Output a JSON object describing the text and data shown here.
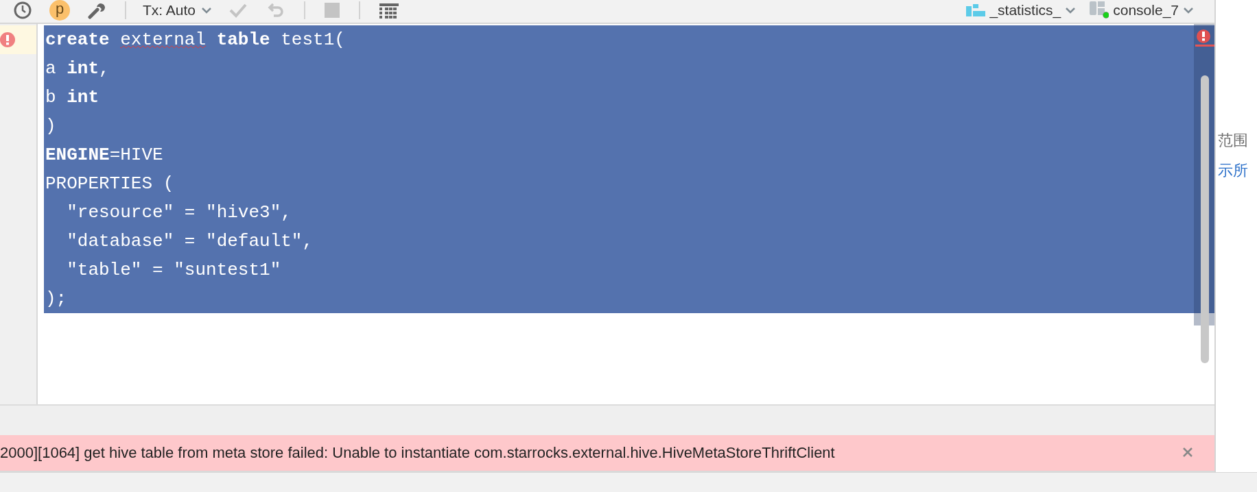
{
  "toolbar": {
    "items": [
      {
        "kind": "history",
        "disabled": false
      },
      {
        "kind": "avatar",
        "text": "p",
        "disabled": false
      },
      {
        "kind": "settings",
        "disabled": false
      },
      {
        "kind": "separator",
        "disabled": false
      },
      {
        "kind": "dropdown",
        "text": "Tx: Auto",
        "disabled": false
      },
      {
        "kind": "commit",
        "disabled": true
      },
      {
        "kind": "rollback",
        "disabled": true
      },
      {
        "kind": "separator",
        "disabled": false
      },
      {
        "kind": "stop",
        "disabled": true
      },
      {
        "kind": "separator",
        "disabled": false
      },
      {
        "kind": "grid",
        "disabled": false
      }
    ],
    "schema": {
      "text": "_statistics_"
    },
    "console": {
      "text": "console_7",
      "connected": true
    }
  },
  "editor": {
    "lines": [
      {
        "selected": true,
        "current": true,
        "error": true,
        "tokens": [
          {
            "text": "create ",
            "kind": "keyword"
          },
          {
            "text": "external",
            "kind": "error"
          },
          {
            "text": " table ",
            "kind": "keyword"
          },
          {
            "text": "test1(",
            "kind": "plain"
          }
        ]
      },
      {
        "selected": true,
        "current": false,
        "error": false,
        "tokens": [
          {
            "text": "a ",
            "kind": "plain"
          },
          {
            "text": "int",
            "kind": "keyword"
          },
          {
            "text": ",",
            "kind": "plain"
          }
        ]
      },
      {
        "selected": true,
        "current": false,
        "error": false,
        "tokens": [
          {
            "text": "b ",
            "kind": "plain"
          },
          {
            "text": "int",
            "kind": "keyword"
          }
        ]
      },
      {
        "selected": true,
        "current": false,
        "error": false,
        "tokens": [
          {
            "text": ")",
            "kind": "plain"
          }
        ]
      },
      {
        "selected": true,
        "current": false,
        "error": false,
        "tokens": [
          {
            "text": "ENGINE",
            "kind": "keyword"
          },
          {
            "text": "=HIVE",
            "kind": "plain"
          }
        ]
      },
      {
        "selected": true,
        "current": false,
        "error": false,
        "tokens": [
          {
            "text": "PROPERTIES (",
            "kind": "plain"
          }
        ]
      },
      {
        "selected": true,
        "current": false,
        "error": false,
        "tokens": [
          {
            "text": "  \"resource\" = \"hive3\",",
            "kind": "plain"
          }
        ]
      },
      {
        "selected": true,
        "current": false,
        "error": false,
        "tokens": [
          {
            "text": "  \"database\" = \"default\",",
            "kind": "plain"
          }
        ]
      },
      {
        "selected": true,
        "current": false,
        "error": false,
        "tokens": [
          {
            "text": "  \"table\" = \"suntest1\"",
            "kind": "plain"
          }
        ]
      },
      {
        "selected": true,
        "current": false,
        "error": false,
        "tokens": [
          {
            "text": ");",
            "kind": "plain"
          }
        ]
      }
    ]
  },
  "side_panel": {
    "lines": [
      {
        "text": "范围",
        "kind": "text"
      },
      {
        "text": "示所",
        "kind": "link"
      }
    ]
  },
  "error_bar": {
    "message": "2000][1064] get hive table from meta store failed: Unable to instantiate com.starrocks.external.hive.HiveMetaStoreThriftClient"
  }
}
